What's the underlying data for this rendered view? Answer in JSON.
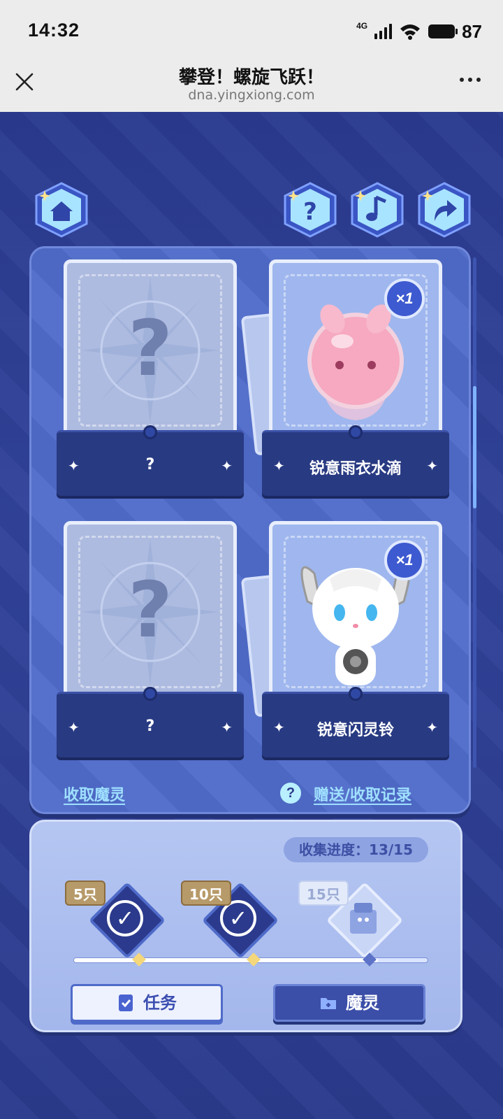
{
  "status_bar": {
    "time": "14:32",
    "network": "4G",
    "battery": "87"
  },
  "browser": {
    "title": "攀登！螺旋飞跃！",
    "url": "dna.yingxiong.com",
    "close_icon": "close-icon",
    "more_icon": "more-icon"
  },
  "toolbar": {
    "icons": [
      "home-icon",
      "help-icon",
      "music-icon",
      "share-icon"
    ]
  },
  "cards": [
    {
      "name": "?",
      "known": false,
      "count": ""
    },
    {
      "name": "锐意雨衣水滴",
      "known": true,
      "count": "×1"
    },
    {
      "name": "?",
      "known": false,
      "count": ""
    },
    {
      "name": "锐意闪灵铃",
      "known": true,
      "count": "×1"
    }
  ],
  "links": {
    "collect": "收取魔灵",
    "help_symbol": "?",
    "records": "赠送/收取记录"
  },
  "progress": {
    "label": "收集进度：",
    "value": "13/15",
    "collected": 13,
    "total": 15,
    "milestones": [
      {
        "label": "5只",
        "done": true
      },
      {
        "label": "10只",
        "done": true
      },
      {
        "label": "15只",
        "done": false
      }
    ],
    "check_symbol": "✓"
  },
  "buttons": {
    "task": "任务",
    "demon": "魔灵"
  },
  "colors": {
    "background": "#2b3a8c",
    "panel": "#4f6bc9",
    "link": "#9fe0ff",
    "card_base": "#283a82"
  }
}
